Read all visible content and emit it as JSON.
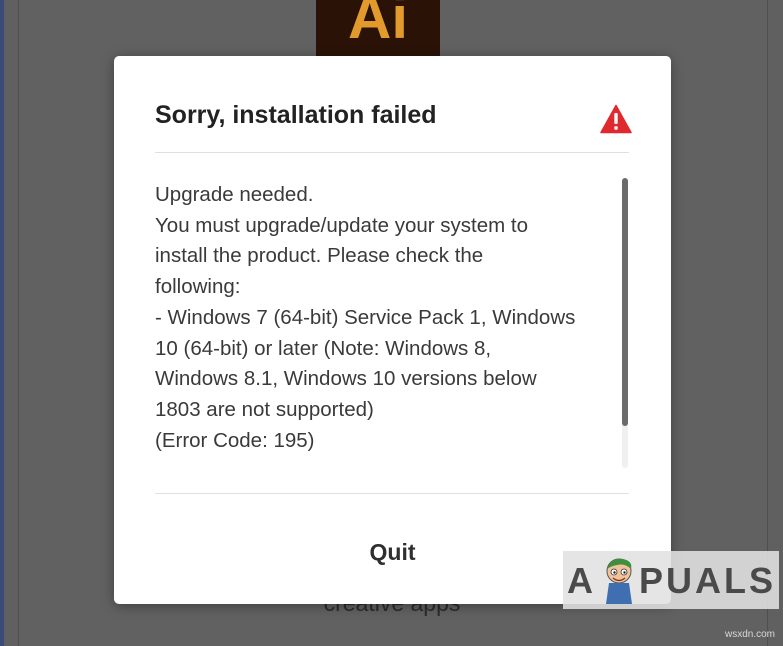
{
  "background": {
    "app_logo_text": "Ai",
    "caption": "creative apps"
  },
  "dialog": {
    "title": "Sorry, installation failed",
    "status_icon": "warning-triangle-icon",
    "message_lines": [
      "Upgrade needed.",
      "You must upgrade/update your system to",
      "install the product. Please check the",
      "following:",
      "- Windows 7 (64-bit) Service Pack 1, Windows",
      "10 (64-bit) or later (Note: Windows 8,",
      "Windows 8.1, Windows 10 versions below",
      "1803 are not supported)",
      "(Error Code: 195)"
    ],
    "quit_label": "Quit"
  },
  "watermark": {
    "brand": "APPUALS",
    "brand_lead": "A",
    "brand_tail": "PUALS",
    "site": "wsxdn.com"
  },
  "colors": {
    "overlay": "#616161",
    "dialog_bg": "#ffffff",
    "warning": "#e0282f",
    "title_text": "#222222",
    "body_text": "#3a3a3a",
    "app_logo_bg": "#2a1306",
    "app_logo_fg": "#e39a2c"
  }
}
